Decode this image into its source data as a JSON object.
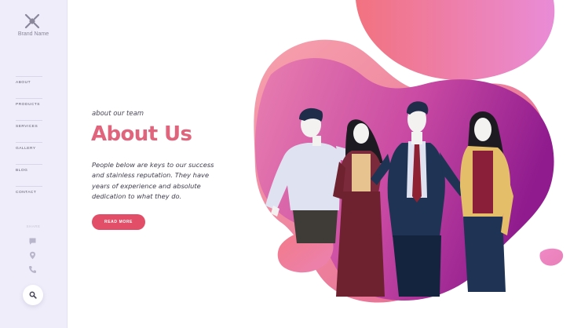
{
  "brand": {
    "name": "Brand Name",
    "logo_icon": "crossed-x-logo-icon"
  },
  "nav": {
    "items": [
      "ABOUT",
      "PRODUCTS",
      "SERVICES",
      "GALLERY",
      "BLOG",
      "CONTACT"
    ]
  },
  "share": {
    "label": "SHARE",
    "icons": [
      "chat-bubble-icon",
      "map-pin-icon",
      "phone-icon"
    ]
  },
  "search": {
    "icon": "search-icon"
  },
  "hero": {
    "kicker": "about our team",
    "title": "About Us",
    "description": "People below are keys to our success and stainless reputation. They have years of experience and absolute dedication to what they do.",
    "cta_label": "READ MORE"
  },
  "colors": {
    "accent": "#e0647c",
    "button": "#e24d67",
    "sidebar": "#efedfa",
    "blob_pink": "#ee7aa3",
    "blob_purple": "#a02d9c"
  }
}
